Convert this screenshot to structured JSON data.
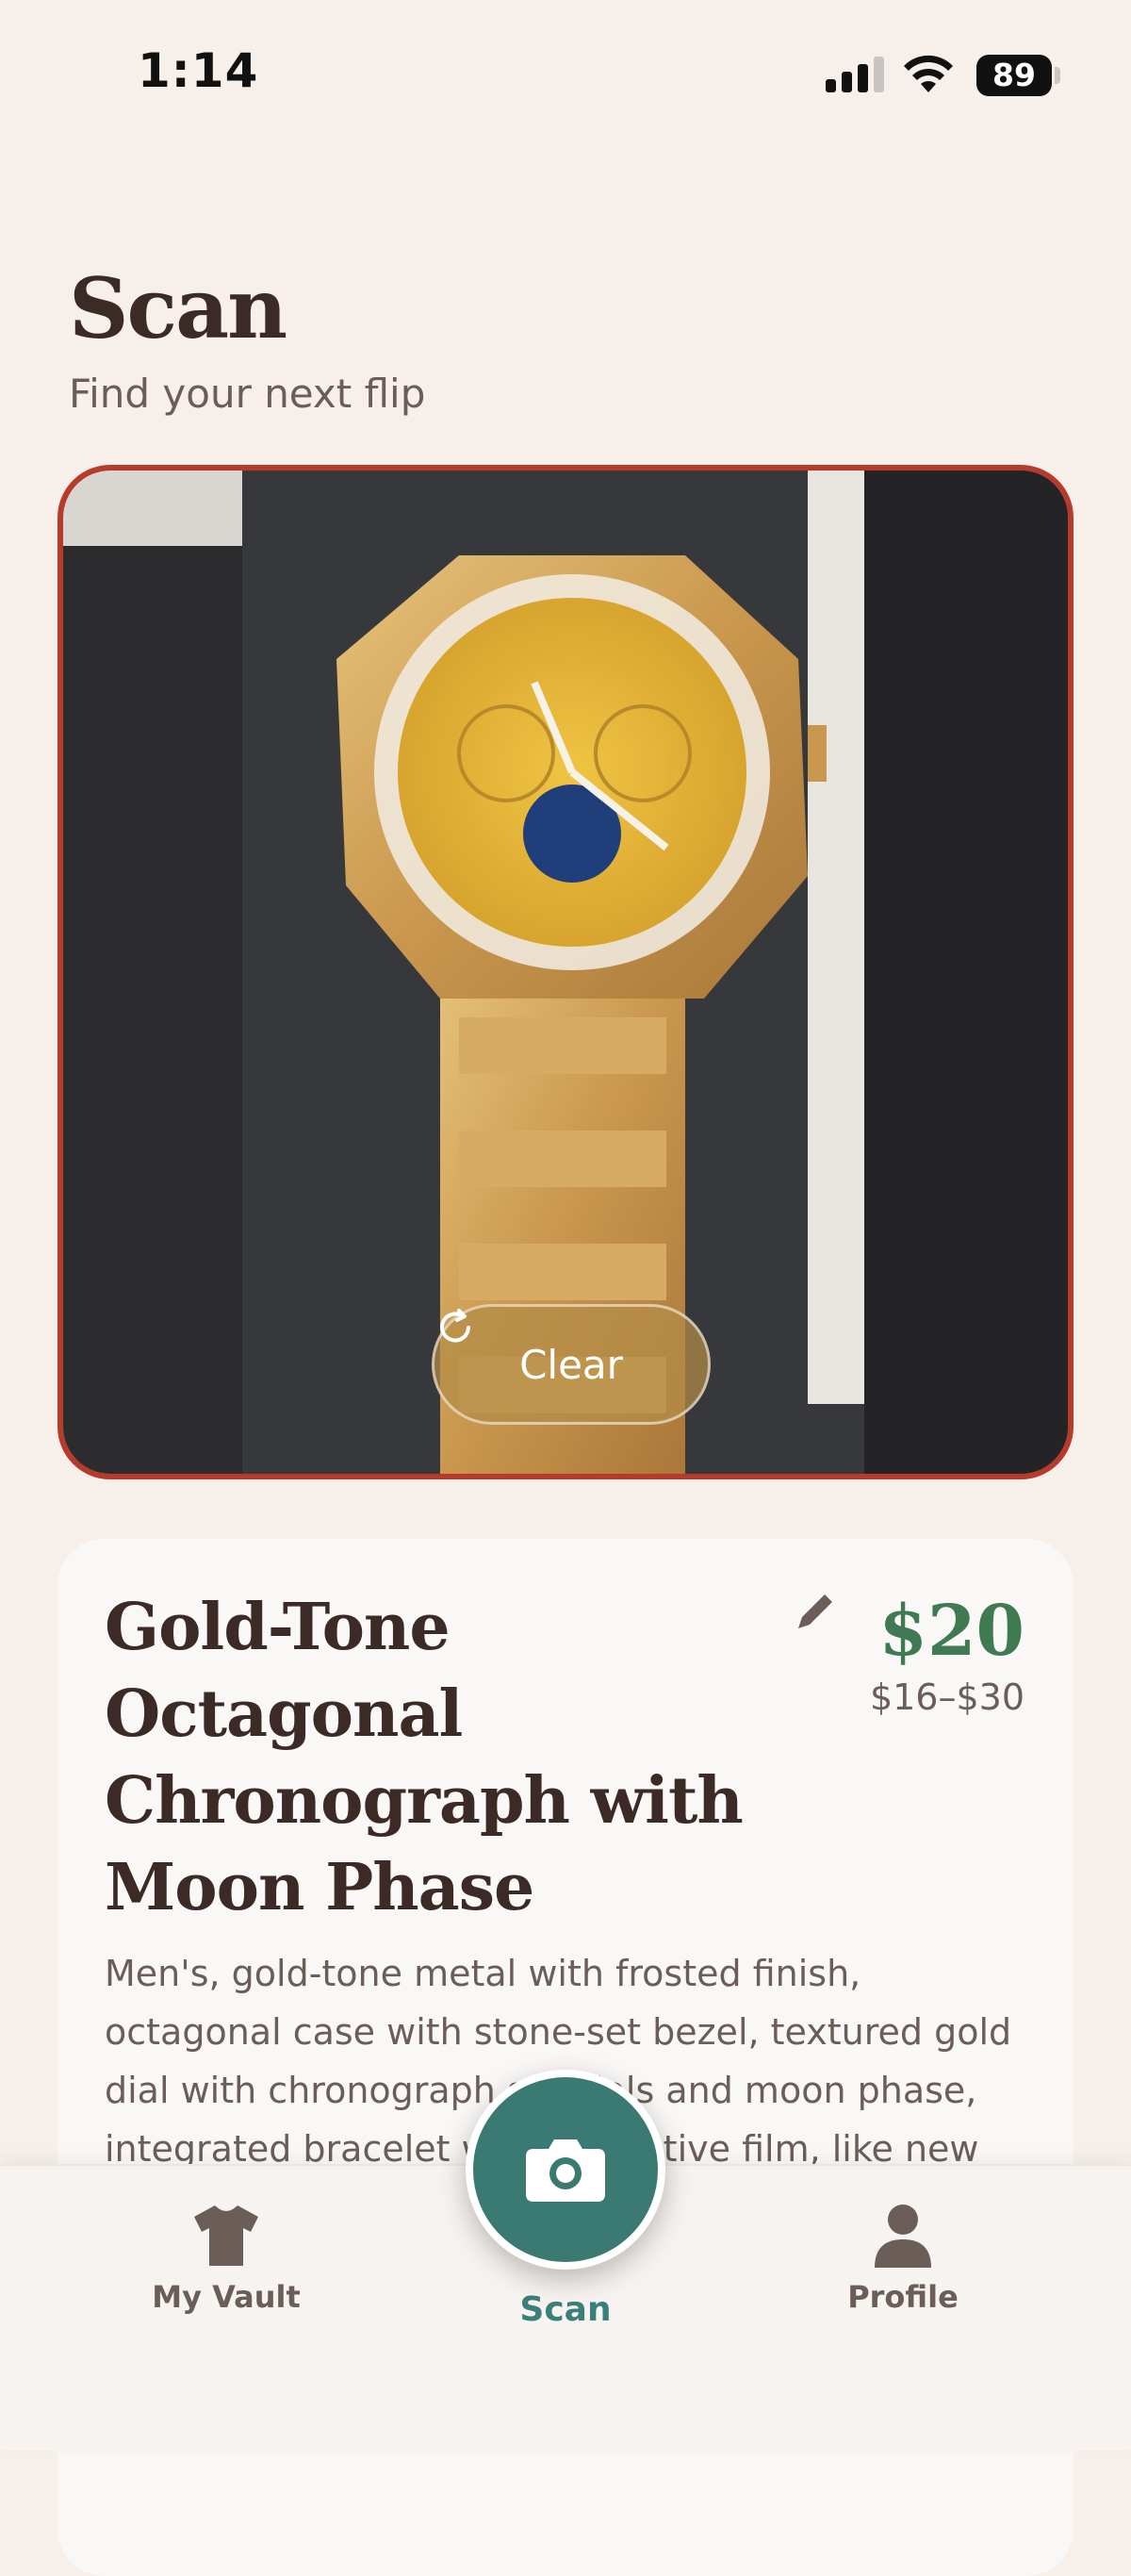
{
  "status_bar": {
    "time": "1:14",
    "battery": "89"
  },
  "header": {
    "title": "Scan",
    "subtitle": "Find your next flip"
  },
  "photo": {
    "clear_label": "Clear"
  },
  "result": {
    "title": "Gold-Tone Octagonal Chronograph with Moon Phase",
    "price": "$20",
    "price_range": "$16–$30",
    "description": "Men's, gold-tone metal with frosted finish, octagonal case with stone-set bezel, textured gold dial with chronograph subdials and moon phase, integrated bracelet with protective film, like new condition."
  },
  "tabs": [
    {
      "label": "My Vault",
      "icon": "shirt-icon"
    },
    {
      "label": "Scan",
      "icon": "camera-icon"
    },
    {
      "label": "Profile",
      "icon": "person-icon"
    }
  ],
  "colors": {
    "accent": "#3a7a72",
    "price": "#3f7a52",
    "frame": "#b83a2a",
    "background": "#f7efe9"
  }
}
